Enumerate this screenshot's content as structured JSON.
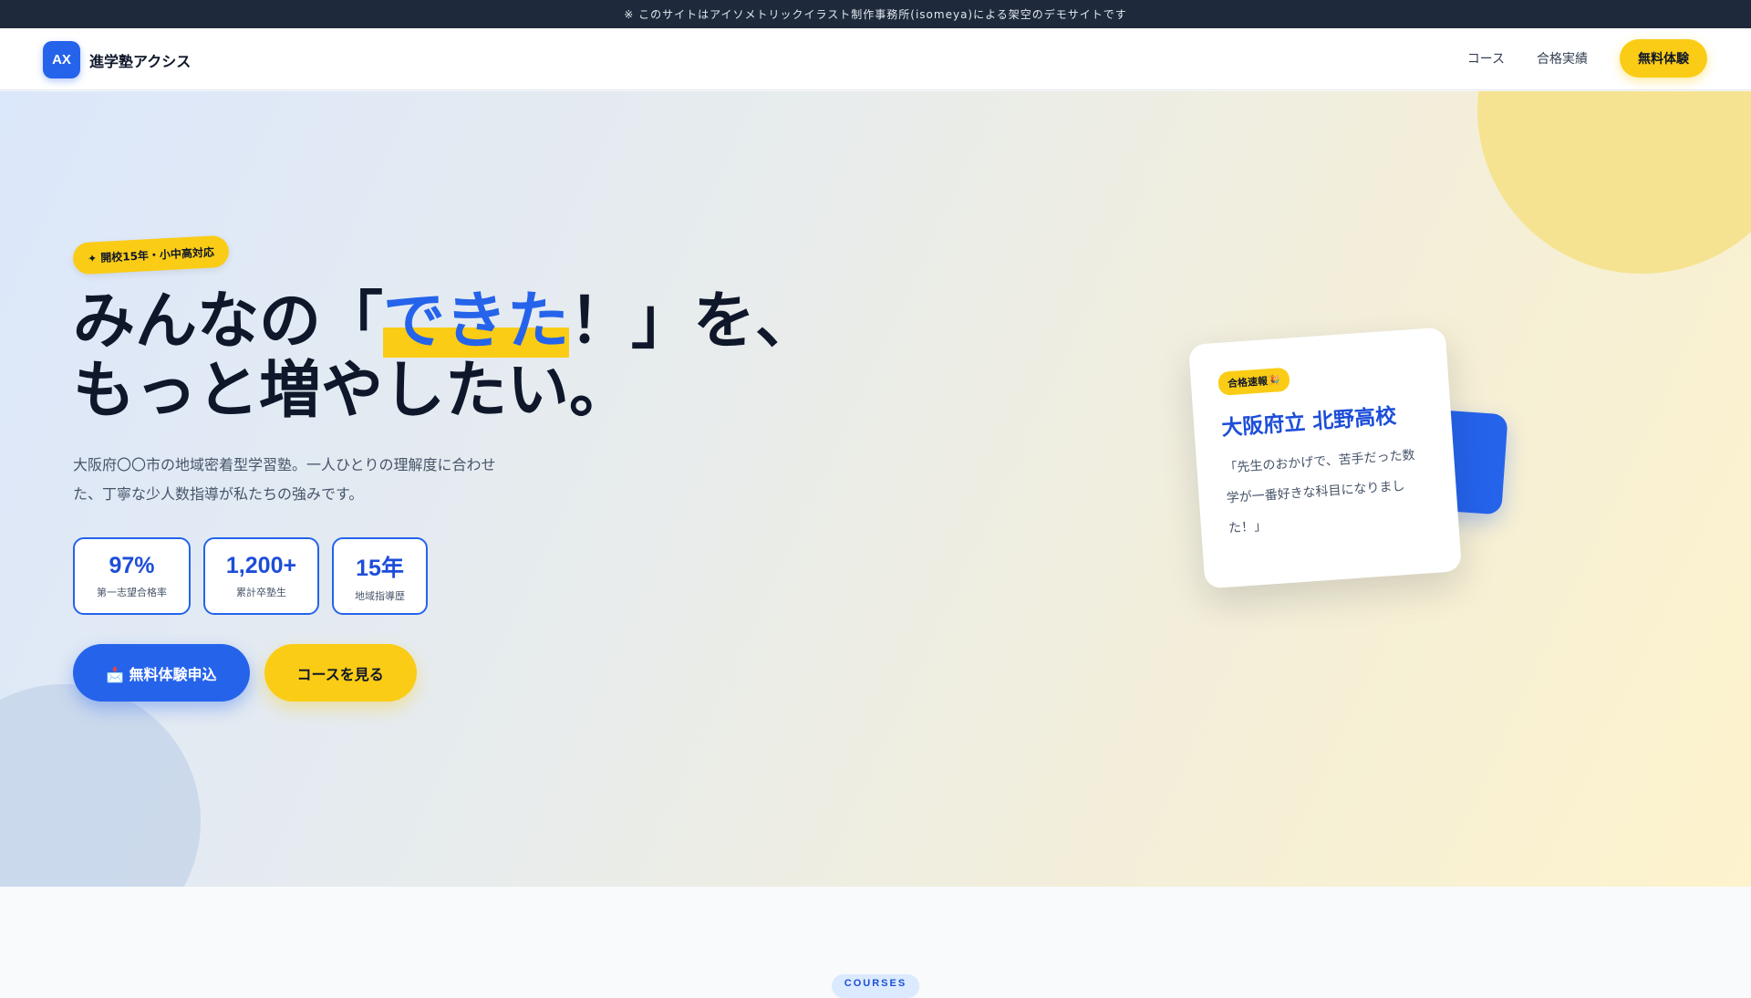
{
  "notice": {
    "text": "※ このサイトはアイソメトリックイラスト制作事務所(isomeya)による架空のデモサイトです"
  },
  "header": {
    "logo_mark": "AX",
    "site_name": "進学塾アクシス",
    "nav": [
      {
        "label": "コース"
      },
      {
        "label": "合格実績"
      }
    ],
    "cta_label": "無料体験"
  },
  "hero": {
    "badge": "✦ 開校15年・小中高対応",
    "headline": {
      "line1_before": "みんなの「",
      "line1_highlight": "できた",
      "line1_after": "！」を、",
      "line2": "もっと増やしたい。"
    },
    "lead": "大阪府〇〇市の地域密着型学習塾。一人ひとりの理解度に合わせた、丁寧な少人数指導が私たちの強みです。",
    "stats": [
      {
        "value": "97%",
        "label": "第一志望合格率"
      },
      {
        "value": "1,200+",
        "label": "累計卒塾生"
      },
      {
        "value": "15年",
        "label": "地域指導歴"
      }
    ],
    "primary_button": "📩 無料体験申込",
    "secondary_button": "コースを見る"
  },
  "result_card": {
    "tag": "合格速報🎉",
    "school": "大阪府立 北野高校",
    "quote": "「先生のおかげで、苦手だった数学が一番好きな科目になりました！」"
  },
  "next_section": {
    "tag": "COURSES"
  },
  "colors": {
    "brand_blue": "#2563eb",
    "accent_yellow": "#facc15",
    "topbar": "#1e293b",
    "text_dark": "#0f172a"
  }
}
